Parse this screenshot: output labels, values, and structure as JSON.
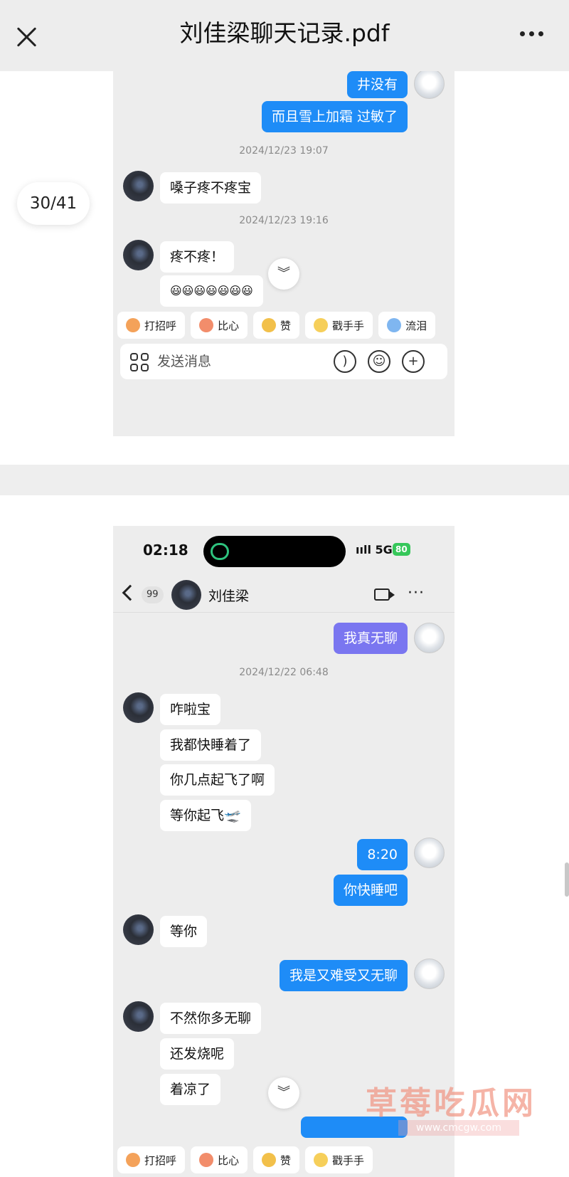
{
  "viewer": {
    "title": "刘佳梁聊天记录.pdf",
    "page_indicator": "30/41"
  },
  "page1": {
    "messages_top": [
      {
        "text": "井没有"
      },
      {
        "text": "而且雪上加霜 过敏了"
      }
    ],
    "ts1": "2024/12/23 19:07",
    "msg_in_1": "嗓子疼不疼宝",
    "ts2": "2024/12/23 19:16",
    "msg_in_2": "疼不疼！",
    "msg_in_3": "😃😃😃😃😃😃😃",
    "chips": [
      "打招呼",
      "比心",
      "赞",
      "戳手手",
      "流泪"
    ],
    "input_placeholder": "发送消息"
  },
  "page2": {
    "status_time": "02:18",
    "signal": "5G",
    "battery": "80",
    "back_count": "99",
    "contact_name": "刘佳梁",
    "msg_out_1": "我真无聊",
    "ts1": "2024/12/22 06:48",
    "in_group_1": [
      "咋啦宝",
      "我都快睡着了",
      "你几点起飞了啊",
      "等你起飞🛫"
    ],
    "out_group_1": [
      "8:20",
      "你快睡吧"
    ],
    "in_2": "等你",
    "out_2": "我是又难受又无聊",
    "in_group_3": [
      "不然你多无聊",
      "还发烧呢",
      "着凉了"
    ],
    "chips": [
      "打招呼",
      "比心",
      "赞",
      "戳手手"
    ]
  },
  "watermark": {
    "text": "草莓吃瓜网",
    "url": "www.cmcgw.com"
  }
}
